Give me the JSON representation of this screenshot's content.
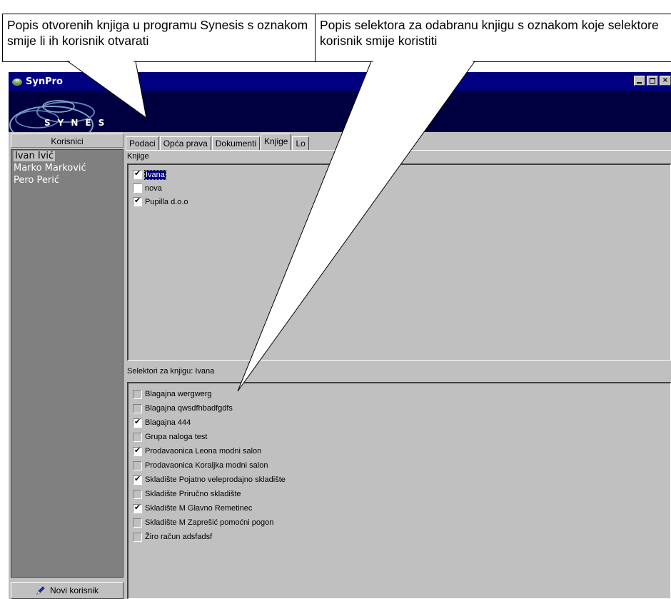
{
  "callouts": {
    "books_text": "Popis otvorenih knjiga u programu Synesis s oznakom smije li ih korisnik otvarati",
    "selectors_text": "Popis selektora za odabranu knjigu s oznakom koje selektore korisnik smije koristiti"
  },
  "window": {
    "title": "SynPro",
    "logo_text": "SYNES"
  },
  "users_panel": {
    "header": "Korisnici",
    "users": [
      "Ivan Ivić",
      "Marko Marković",
      "Pero Perić"
    ],
    "new_user_label": "Novi korisnik"
  },
  "tabs": [
    "Podaci",
    "Opća prava",
    "Dokumenti",
    "Knjige",
    "Lo"
  ],
  "books": {
    "label": "Knjige",
    "items": [
      {
        "name": "Ivana",
        "checked": true
      },
      {
        "name": "nova",
        "checked": false
      },
      {
        "name": "Pupilla d.o.o",
        "checked": true
      }
    ]
  },
  "selectors": {
    "label": "Selektori za knjigu: Ivana",
    "items": [
      {
        "name": "Blagajna wergwerg",
        "checked": false
      },
      {
        "name": "Blagajna qwsdfhbadfgdfs",
        "checked": false
      },
      {
        "name": "Blagajna 444",
        "checked": true
      },
      {
        "name": "Grupa naloga test",
        "checked": false
      },
      {
        "name": "Prodavaonica Leona modni salon",
        "checked": true
      },
      {
        "name": "Prodavaonica Koraljka modni salon",
        "checked": false
      },
      {
        "name": "Skladište Pojatno veleprodajno skladište",
        "checked": true
      },
      {
        "name": "Skladište Priručno skladište",
        "checked": false
      },
      {
        "name": "Skladište M Glavno Remetinec",
        "checked": true
      },
      {
        "name": "Skladište M Zaprešić pomoćni pogon",
        "checked": false
      },
      {
        "name": "Žiro račun adsfadsf",
        "checked": false
      }
    ]
  },
  "colors": {
    "titlebar": "#000080",
    "banner": "#000040",
    "panel": "#c0c0c0",
    "users_list": "#808080"
  }
}
